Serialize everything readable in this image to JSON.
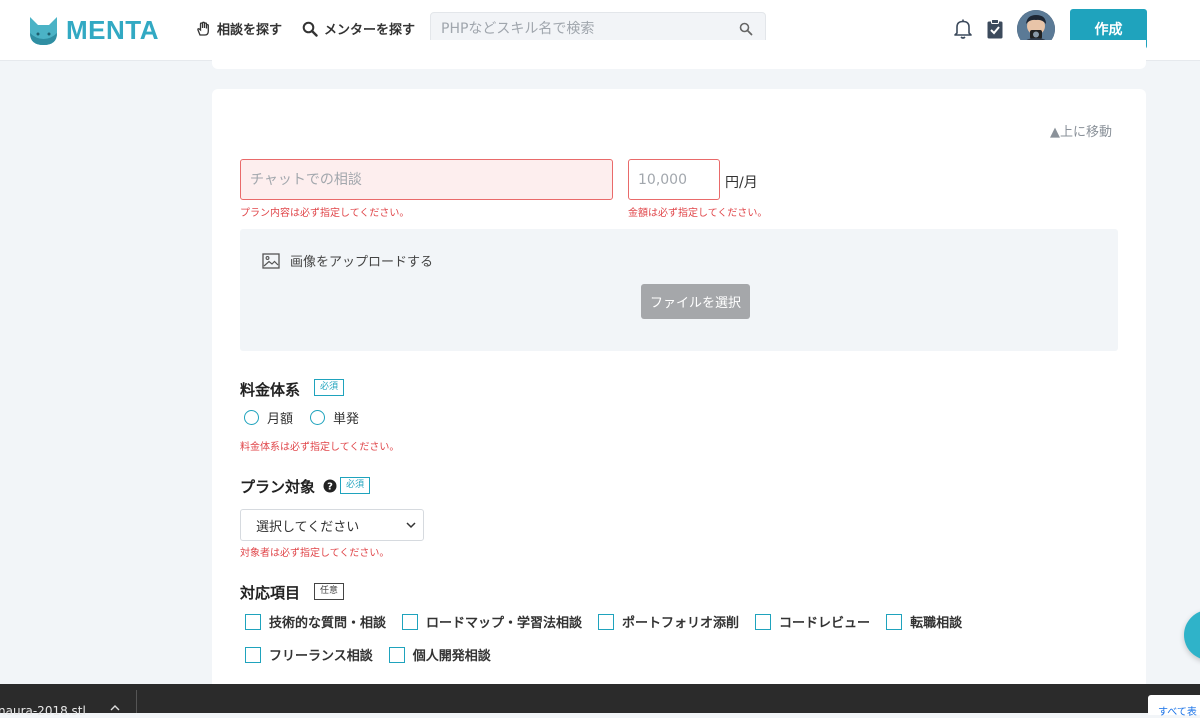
{
  "header": {
    "logo_text": "MENTA",
    "nav_consult": "相談を探す",
    "nav_mentor": "メンターを探す",
    "search_placeholder": "PHPなどスキル名で検索",
    "create_label": "作成"
  },
  "form": {
    "move_up": "▲上に移動",
    "plan_placeholder": "チャットでの相談",
    "plan_error": "プラン内容は必ず指定してください。",
    "price_placeholder": "10,000",
    "price_unit": "円/月",
    "price_error": "金額は必ず指定してください。",
    "upload_label": "画像をアップロードする",
    "file_button": "ファイルを選択",
    "fee_title": "料金体系",
    "required_badge": "必須",
    "optional_badge": "任意",
    "fee_options": [
      "月額",
      "単発"
    ],
    "fee_error": "料金体系は必ず指定してください。",
    "target_title": "プラン対象",
    "target_select": "選択してください",
    "target_error": "対象者は必ず指定してください。",
    "items_title": "対応項目",
    "items": [
      "技術的な質問・相談",
      "ロードマップ・学習法相談",
      "ポートフォリオ添削",
      "コードレビュー",
      "転職相談",
      "フリーランス相談",
      "個人開発相談"
    ]
  },
  "download_bar": {
    "file_name": "naura-2018.stl",
    "show_all": "すべて表"
  },
  "colors": {
    "accent": "#1fa3bd",
    "error": "#e0464a",
    "background": "#f2f5f8"
  }
}
